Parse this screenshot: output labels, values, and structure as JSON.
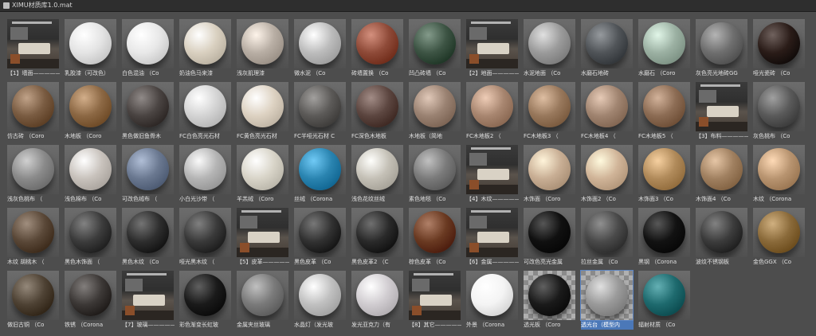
{
  "window": {
    "title": "XIMU材质库1.0.mat"
  },
  "materials": [
    {
      "label": "【1】墙面——————",
      "kind": "room"
    },
    {
      "label": "乳胶漆（可改色）",
      "kind": "sphere",
      "color": "#e4e4e4"
    },
    {
      "label": "白色混油  （Co",
      "kind": "sphere",
      "color": "#e8e8e8"
    },
    {
      "label": "奶油色马来漆",
      "kind": "sphere",
      "color": "#d9d0c0"
    },
    {
      "label": "浅灰肌理漆",
      "kind": "sphere",
      "color": "#b8aea4"
    },
    {
      "label": "微水泥  （Co",
      "kind": "sphere",
      "color": "#bcbcbc"
    },
    {
      "label": "砖墙置换  （Co",
      "kind": "sphere",
      "color": "#8e4a38"
    },
    {
      "label": "凹凸砖墙  （Co",
      "kind": "sphere",
      "color": "#3d5444"
    },
    {
      "label": "【2】地面——————",
      "kind": "room"
    },
    {
      "label": "水泥地面  （Co",
      "kind": "sphere",
      "color": "#9a9a9a"
    },
    {
      "label": "水磨石地砖",
      "kind": "sphere",
      "color": "#505458"
    },
    {
      "label": "水磨石  （Coro",
      "kind": "sphere",
      "color": "#9bb0a2"
    },
    {
      "label": "灰色亮光地砖GG",
      "kind": "sphere",
      "color": "#6e6e6e"
    },
    {
      "label": "哑光瓷砖  （Co",
      "kind": "sphere",
      "color": "#2a1c18"
    },
    {
      "label": "仿古砖  （Coro",
      "kind": "sphere",
      "color": "#7a5c42"
    },
    {
      "label": "木地板  （Coro",
      "kind": "sphere",
      "color": "#8c6844"
    },
    {
      "label": "黑色做旧鱼骨木",
      "kind": "sphere",
      "color": "#4a4442"
    },
    {
      "label": "FC白色亮光石材",
      "kind": "sphere",
      "color": "#d4d4d4"
    },
    {
      "label": "FC黄色亮光石材",
      "kind": "sphere",
      "color": "#ddd2c2"
    },
    {
      "label": "FC半哑光石材 C",
      "kind": "sphere",
      "color": "#5c5a58"
    },
    {
      "label": "FC深色木地板",
      "kind": "sphere",
      "color": "#5c4640"
    },
    {
      "label": "木地板（简地",
      "kind": "sphere",
      "color": "#9a8272"
    },
    {
      "label": "FC木地板2  （",
      "kind": "sphere",
      "color": "#a88670"
    },
    {
      "label": "FC木地板3  （",
      "kind": "sphere",
      "color": "#98785c"
    },
    {
      "label": "FC木地板4  （",
      "kind": "sphere",
      "color": "#a08470"
    },
    {
      "label": "FC木地板5  （",
      "kind": "sphere",
      "color": "#8c6c54"
    },
    {
      "label": "【3】布料——————",
      "kind": "room"
    },
    {
      "label": "灰色桃布  （Co",
      "kind": "sphere",
      "color": "#5a5a5a"
    },
    {
      "label": "浅灰色桃布  （",
      "kind": "sphere",
      "color": "#8a8a8a"
    },
    {
      "label": "浅色棉布  （Co",
      "kind": "sphere",
      "color": "#c8c2bc"
    },
    {
      "label": "可改色绒布  （",
      "kind": "sphere",
      "color": "#6a7890"
    },
    {
      "label": "小白光沙带  （",
      "kind": "sphere",
      "color": "#b4b4b4"
    },
    {
      "label": "羊羔绒  （Coro",
      "kind": "sphere",
      "color": "#d8d4c8"
    },
    {
      "label": "丝绒  （Corona",
      "kind": "sphere",
      "color": "#2a84b0"
    },
    {
      "label": "浅色花纹丝绒",
      "kind": "sphere",
      "color": "#c4c0b6"
    },
    {
      "label": "素色地毯  （Co",
      "kind": "sphere",
      "color": "#7a7a7a"
    },
    {
      "label": "【4】木纹——————",
      "kind": "room"
    },
    {
      "label": "木饰面  （Coro",
      "kind": "sphere",
      "color": "#c8ae94"
    },
    {
      "label": "木饰面2  （Co",
      "kind": "sphere",
      "color": "#d0b498"
    },
    {
      "label": "木饰面3  （Co",
      "kind": "sphere",
      "color": "#b08a5a"
    },
    {
      "label": "木饰面4  （Co",
      "kind": "sphere",
      "color": "#a08060"
    },
    {
      "label": "木纹  （Corona",
      "kind": "sphere",
      "color": "#b89470"
    },
    {
      "label": "木纹 胡桃木  （",
      "kind": "sphere",
      "color": "#5a4838"
    },
    {
      "label": "黑色木饰面  （",
      "kind": "sphere",
      "color": "#3c3c3c"
    },
    {
      "label": "黑色木纹  （Co",
      "kind": "sphere",
      "color": "#2e2e2e"
    },
    {
      "label": "哑光黑木纹  （",
      "kind": "sphere",
      "color": "#3a3a3a"
    },
    {
      "label": "【5】皮革——————",
      "kind": "room"
    },
    {
      "label": "黑色皮革  （Co",
      "kind": "sphere",
      "color": "#323232"
    },
    {
      "label": "黑色皮革2  （C",
      "kind": "sphere",
      "color": "#2a2a2a"
    },
    {
      "label": "棕色皮革  （Co",
      "kind": "sphere",
      "color": "#6a3a22"
    },
    {
      "label": "【6】金属——————",
      "kind": "room"
    },
    {
      "label": "可改色亮光金属",
      "kind": "sphere",
      "color": "#101010"
    },
    {
      "label": "拉丝金属  （Co",
      "kind": "sphere",
      "color": "#4a4a4a"
    },
    {
      "label": "黑钢  （Corona",
      "kind": "sphere",
      "color": "#121212"
    },
    {
      "label": "波纹不锈钢板",
      "kind": "sphere",
      "color": "#3c3c3c"
    },
    {
      "label": "金色GGX  （Co",
      "kind": "sphere",
      "color": "#8a6a3a"
    },
    {
      "label": "做旧古铜  （Co",
      "kind": "sphere",
      "color": "#4e4234"
    },
    {
      "label": "铁锈  （Corona",
      "kind": "sphere",
      "color": "#3c3836"
    },
    {
      "label": "【7】玻璃——————",
      "kind": "room"
    },
    {
      "label": "彩色渐变长虹玻",
      "kind": "sphere",
      "color": "#1a1a1a"
    },
    {
      "label": "金属夹丝玻璃",
      "kind": "sphere",
      "color": "#7a7a7a"
    },
    {
      "label": "水晶灯（发光玻",
      "kind": "sphere",
      "color": "#c0c0c0"
    },
    {
      "label": "发光亚克力（有",
      "kind": "sphere",
      "color": "#d0ccd0"
    },
    {
      "label": "【8】其它——————",
      "kind": "room"
    },
    {
      "label": "外景  （Corona",
      "kind": "sphere",
      "color": "#f4f4f4"
    },
    {
      "label": "透光板  （Coro",
      "kind": "checker",
      "color": "#1a1a1a"
    },
    {
      "label": "透光台（模型内",
      "kind": "checker",
      "color": "#9a9a9a",
      "selected": true
    },
    {
      "label": "辐射材质  （Co",
      "kind": "sphere",
      "color": "#1e6a6e"
    }
  ]
}
